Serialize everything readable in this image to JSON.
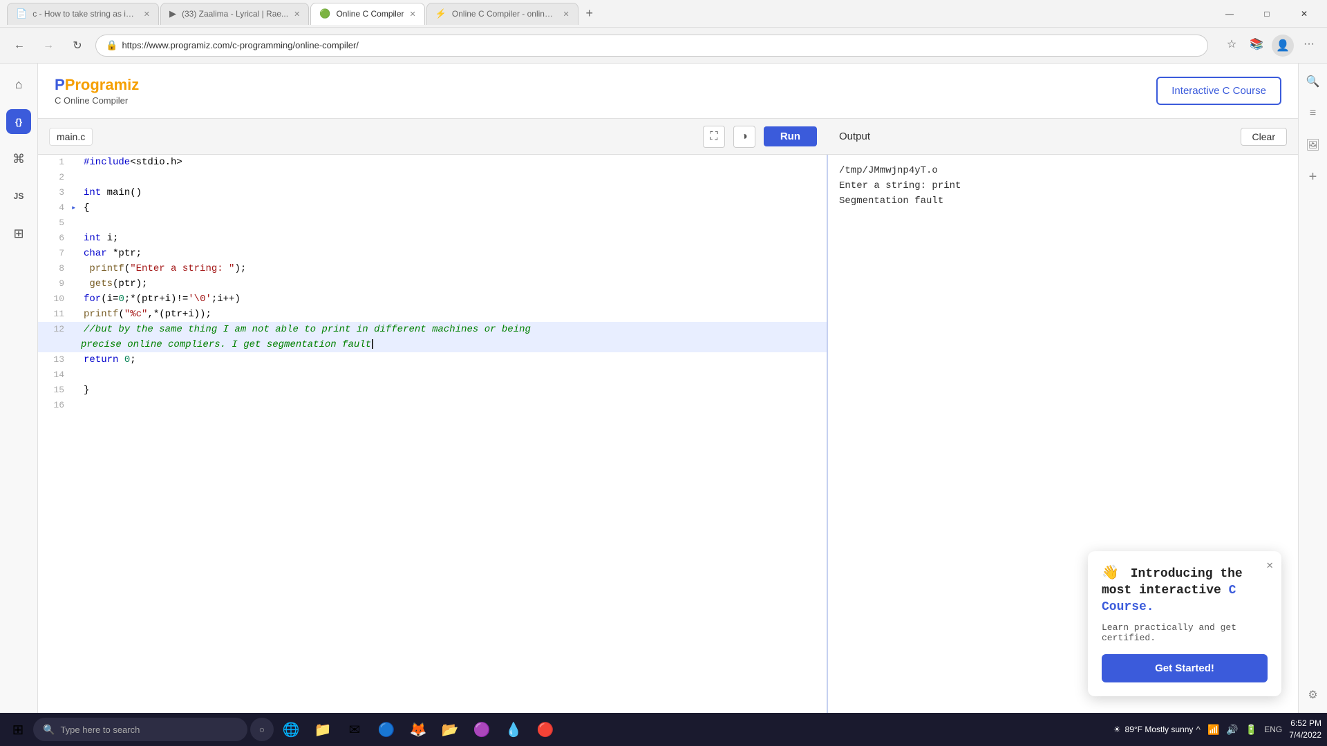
{
  "browser": {
    "tabs": [
      {
        "id": "tab1",
        "title": "c - How to take string as input u...",
        "favicon": "📄",
        "active": false
      },
      {
        "id": "tab2",
        "title": "(33) Zaalima - Lyrical | Rae...",
        "favicon": "▶",
        "active": false
      },
      {
        "id": "tab3",
        "title": "Online C Compiler",
        "favicon": "🟢",
        "active": true
      },
      {
        "id": "tab4",
        "title": "Online C Compiler - online edit...",
        "favicon": "⚡",
        "active": false
      }
    ],
    "url": "https://www.programiz.com/c-programming/online-compiler/",
    "close_label": "✕",
    "minimize_label": "—",
    "maximize_label": "□",
    "back_label": "←",
    "forward_label": "→",
    "refresh_label": "↻"
  },
  "header": {
    "logo_text": "Programiz",
    "logo_subtitle": "C Online Compiler",
    "interactive_course_btn": "Interactive C Course"
  },
  "editor": {
    "file_tab": "main.c",
    "run_btn": "Run",
    "fullscreen_icon": "⛶",
    "theme_icon": "◑",
    "lines": [
      {
        "num": 1,
        "marker": "",
        "content": "#include<stdio.h>",
        "highlight": false
      },
      {
        "num": 2,
        "marker": "",
        "content": "",
        "highlight": false
      },
      {
        "num": 3,
        "marker": "",
        "content": "int main()",
        "highlight": false
      },
      {
        "num": 4,
        "marker": "▸",
        "content": "{",
        "highlight": false
      },
      {
        "num": 5,
        "marker": "",
        "content": "",
        "highlight": false
      },
      {
        "num": 6,
        "marker": "",
        "content": "int i;",
        "highlight": false
      },
      {
        "num": 7,
        "marker": "",
        "content": "char *ptr;",
        "highlight": false
      },
      {
        "num": 8,
        "marker": "",
        "content": "printf(\"Enter a string: \");",
        "highlight": false
      },
      {
        "num": 9,
        "marker": "",
        "content": "gets(ptr);",
        "highlight": false
      },
      {
        "num": 10,
        "marker": "",
        "content": "for(i=0;*(ptr+i)!='\\0';i++)",
        "highlight": false
      },
      {
        "num": 11,
        "marker": "",
        "content": "printf(\"%c\",*(ptr+i));",
        "highlight": false
      },
      {
        "num": 12,
        "marker": "",
        "content": "//but by the same thing I am not able to print in different machines or being\n        precise online compliers. I get segmentation fault",
        "highlight": true
      },
      {
        "num": 13,
        "marker": "",
        "content": "return 0;",
        "highlight": false
      },
      {
        "num": 14,
        "marker": "",
        "content": "",
        "highlight": false
      },
      {
        "num": 15,
        "marker": "",
        "content": "}",
        "highlight": false
      },
      {
        "num": 16,
        "marker": "",
        "content": "",
        "highlight": false
      }
    ]
  },
  "output": {
    "title": "Output",
    "clear_btn": "Clear",
    "lines": [
      "/tmp/JMmwjnp4yT.o",
      "Enter a string: print",
      "Segmentation fault"
    ]
  },
  "popup": {
    "emoji": "👋",
    "title_part1": "Introducing the most interactive ",
    "title_highlight": "C Course.",
    "subtitle": "Learn practically and get certified.",
    "cta_label": "Get Started!",
    "close_icon": "✕"
  },
  "right_sidebar": {
    "icons": [
      "🔍",
      "≡",
      "🖼",
      "⚙"
    ]
  },
  "left_sidebar": {
    "icons": [
      {
        "name": "home",
        "glyph": "⌂",
        "active": false
      },
      {
        "name": "code",
        "glyph": "{ }",
        "active": true
      },
      {
        "name": "terminal",
        "glyph": "⌘",
        "active": false
      },
      {
        "name": "js",
        "glyph": "JS",
        "active": false
      },
      {
        "name": "database",
        "glyph": "⊞",
        "active": false
      }
    ]
  },
  "taskbar": {
    "start_icon": "⊞",
    "search_placeholder": "Type here to search",
    "time": "6:52 PM",
    "date": "7/4/2022",
    "weather": "89°F  Mostly sunny",
    "weather_icon": "☀",
    "apps": [
      {
        "name": "Edge",
        "glyph": "🌐"
      },
      {
        "name": "Explorer",
        "glyph": "📁"
      },
      {
        "name": "Mail",
        "glyph": "✉"
      },
      {
        "name": "Browser",
        "glyph": "🔵"
      },
      {
        "name": "Firefox",
        "glyph": "🦊"
      },
      {
        "name": "Files",
        "glyph": "📂"
      },
      {
        "name": "App1",
        "glyph": "🟣"
      },
      {
        "name": "App2",
        "glyph": "💧"
      },
      {
        "name": "App3",
        "glyph": "🔴"
      }
    ],
    "systray": {
      "lang": "ENG",
      "battery": "🔋",
      "network": "📶",
      "sound": "🔊",
      "chevron": "^"
    }
  }
}
